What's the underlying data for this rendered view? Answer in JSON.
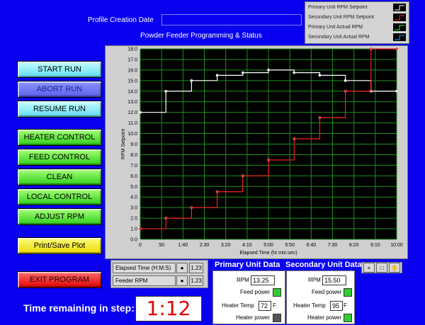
{
  "header": {
    "profile_label": "Profile Creation Date",
    "profile_value": "",
    "chart_title": "Powder Feeder Programming & Status"
  },
  "legend": {
    "items": [
      {
        "label": "Primary Unit RPM Setpoint",
        "color": "#ffffff"
      },
      {
        "label": "Secondary Unit RPM Setpoint",
        "color": "#ff2020"
      },
      {
        "label": "Primary Unit Actual RPM",
        "color": "#20ff20"
      },
      {
        "label": "Secondary Unit Actual RPM",
        "color": "#20a0ff"
      }
    ]
  },
  "buttons": {
    "start_run": "START RUN",
    "abort_run": "ABORT RUN",
    "resume_run": "RESUME RUN",
    "heater_control": "HEATER CONTROL",
    "feed_control": "FEED CONTROL",
    "clean": "CLEAN",
    "local_control": "LOCAL CONTROL",
    "adjust_rpm": "ADJUST RPM",
    "print_save": "Print/Save Plot",
    "exit": "EXIT PROGRAM"
  },
  "chart_controls": {
    "x_selector": "Elapsed Time (H:M:S)",
    "y_selector": "Feeder RPM",
    "x_fmt": "1.23",
    "y_fmt": "1.23"
  },
  "chart_data": {
    "type": "line",
    "xlabel": "Elapsed Time (hr:min:sec)",
    "ylabel": "RPM Setpoint",
    "xlim": [
      0,
      600
    ],
    "ylim": [
      0,
      18
    ],
    "x_ticks": [
      {
        "v": 0,
        "label": "0"
      },
      {
        "v": 50,
        "label": "50"
      },
      {
        "v": 100,
        "label": "1:40"
      },
      {
        "v": 150,
        "label": "2:30"
      },
      {
        "v": 200,
        "label": "3:20"
      },
      {
        "v": 250,
        "label": "4:10"
      },
      {
        "v": 300,
        "label": "5:00"
      },
      {
        "v": 350,
        "label": "5:50"
      },
      {
        "v": 400,
        "label": "6:40"
      },
      {
        "v": 450,
        "label": "7:30"
      },
      {
        "v": 500,
        "label": "8:20"
      },
      {
        "v": 550,
        "label": "9:10"
      },
      {
        "v": 600,
        "label": "10:00"
      }
    ],
    "y_ticks": [
      "0.0",
      "1.0",
      "2.0",
      "3.0",
      "4.0",
      "5.0",
      "6.0",
      "7.0",
      "8.0",
      "9.0",
      "10.0",
      "11.0",
      "12.0",
      "13.0",
      "14.0",
      "15.0",
      "16.0",
      "17.0",
      "18.0"
    ],
    "grid": true,
    "series": [
      {
        "name": "Primary Unit RPM Setpoint",
        "color": "#ffffff",
        "x": [
          0,
          60,
          120,
          180,
          240,
          300,
          360,
          420,
          480,
          540,
          600
        ],
        "y": [
          12.0,
          14.0,
          15.0,
          15.5,
          15.75,
          16.0,
          15.75,
          15.5,
          15.0,
          14.0,
          14.0
        ]
      },
      {
        "name": "Secondary Unit RPM Setpoint",
        "color": "#ff2020",
        "x": [
          0,
          60,
          120,
          180,
          240,
          300,
          360,
          420,
          480,
          540,
          600
        ],
        "y": [
          1.0,
          2.0,
          3.0,
          4.5,
          6.0,
          7.5,
          9.5,
          11.5,
          14.0,
          18.0,
          18.0
        ]
      }
    ]
  },
  "primary": {
    "title": "Primary Unit Data",
    "rpm_label": "RPM",
    "rpm_value": "13.25",
    "feed_power_label": "Feed power",
    "heater_temp_label": "Heater Temp",
    "heater_temp_value": "72",
    "temp_unit": "F",
    "heater_power_label": "Heater power",
    "feed_led_color": "#33cc33",
    "heater_led_color": "#555555"
  },
  "secondary": {
    "title": "Secondary Unit Data",
    "rpm_label": "RPM",
    "rpm_value": "15.50",
    "feed_power_label": "Feed power",
    "heater_temp_label": "Heater Temp",
    "heater_temp_value": "95",
    "temp_unit": "F",
    "heater_power_label": "Heater power",
    "feed_led_color": "#33cc33",
    "heater_led_color": "#33cc33"
  },
  "footer": {
    "time_label": "Time remaining in step:",
    "time_value": "1:12"
  }
}
